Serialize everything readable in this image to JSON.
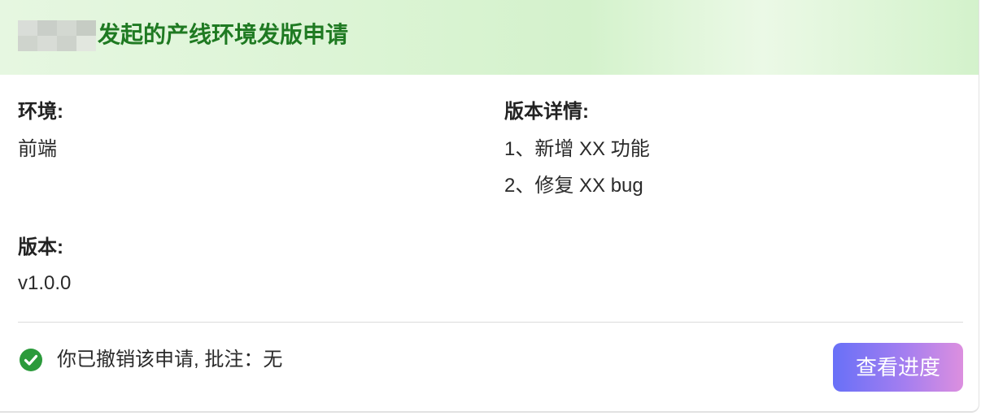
{
  "header": {
    "title": "发起的产线环境发版申请"
  },
  "fields": {
    "environment": {
      "label": "环境:",
      "value": "前端"
    },
    "version": {
      "label": "版本:",
      "value": "v1.0.0"
    },
    "details": {
      "label": "版本详情:",
      "lines": [
        "1、新增 XX 功能",
        "2、修复 XX bug"
      ]
    }
  },
  "footer": {
    "status_icon": "check-circle-icon",
    "status_text": "你已撤销该申请, 批注：无",
    "button_label": "查看进度"
  },
  "colors": {
    "title": "#1f7a22",
    "status_icon": "#2b9a3b",
    "button_gradient_start": "#6870f7",
    "button_gradient_end": "#dc8fdf"
  }
}
